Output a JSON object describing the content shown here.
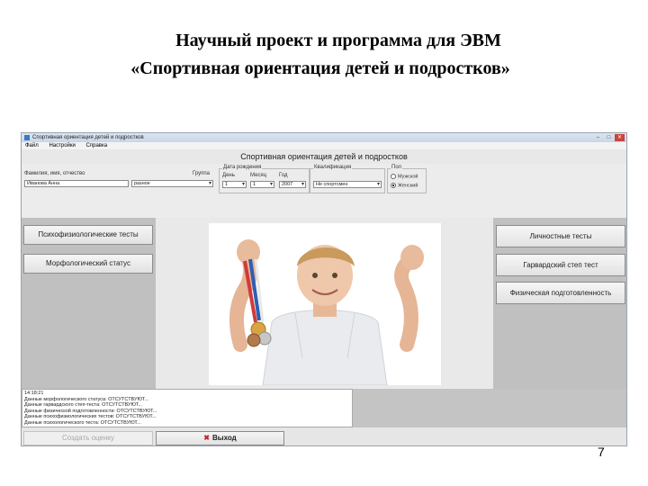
{
  "slide": {
    "title_line1": "Научный проект и программа для ЭВМ",
    "title_line2": "«Спортивная ориентация детей и подростков»",
    "page_number": "7"
  },
  "window": {
    "title": "Спортивная ориентация детей и подростков",
    "controls": [
      "–",
      "□",
      "✕"
    ]
  },
  "menu": [
    "Файл",
    "Настройки",
    "Справка"
  ],
  "form": {
    "header": "Спортивная ориентация детей и подростков",
    "name_label": "Фамилия, имя, отчество",
    "name_value": "Иванова Анна",
    "group_label": "Группа",
    "group_value": "разное",
    "birth_label": "Дата рождения",
    "day_label": "День",
    "day_value": "1",
    "month_label": "Месяц",
    "month_value": "1",
    "year_label": "Год",
    "year_value": "2007",
    "qual_label": "Квалификация",
    "qual_value": "Не спортсмен",
    "sex_label": "Пол",
    "sex_options": [
      "Мужской",
      "Женский"
    ],
    "sex_selected": "Женский"
  },
  "buttons": {
    "psycho": "Психофизиологические тесты",
    "morpho": "Морфологический статус",
    "personal": "Личностные тесты",
    "harvard": "Гарвардский степ тест",
    "physical": "Физическая подготовленность",
    "create": "Создать оценку",
    "exit": "Выход"
  },
  "log_lines": [
    "14:18:21",
    "Данные морфологического статуса: ОТСУТСТВУЮТ...",
    "Данные гарвардского степ-теста: ОТСУТСТВУЮТ...",
    "Данные физической подготовленности: ОТСУТСТВУЮТ...",
    "Данные психофизиологических тестов: ОТСУТСТВУЮТ...",
    "Данные психологического теста: ОТСУТСТВУЮТ..."
  ],
  "colors": {
    "exit_icon": "#c0282d",
    "titlebar": "#c8d6e8",
    "panel_gray": "#c0c0c0"
  }
}
